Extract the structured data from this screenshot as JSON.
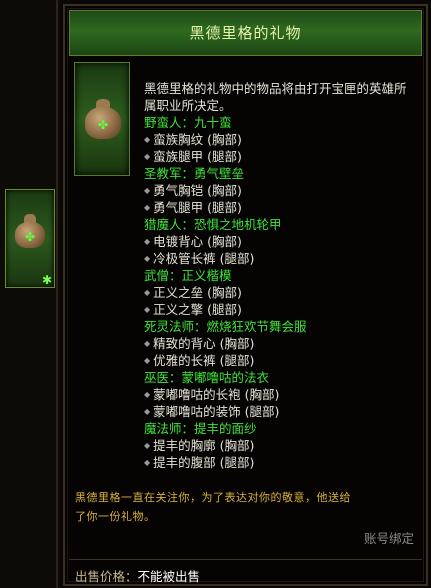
{
  "tooltip": {
    "title": "黑德里格的礼物",
    "description": "黑德里格的礼物中的物品将由打开宝匣的英雄所属职业所决定。",
    "classes": [
      {
        "header": "野蛮人：九十蛮",
        "items": [
          "蛮族胸纹 (胸部)",
          "蛮族腿甲 (腿部)"
        ]
      },
      {
        "header": "圣教军：勇气壁垒",
        "items": [
          "勇气胸铠 (胸部)",
          "勇气腿甲 (腿部)"
        ]
      },
      {
        "header": "猎魔人：恐惧之地机轮甲",
        "items": [
          "电镀背心 (胸部)",
          "冷极管长裤 (腿部)"
        ]
      },
      {
        "header": "武僧：正义楷模",
        "items": [
          "正义之垒 (胸部)",
          "正义之擎 (腿部)"
        ]
      },
      {
        "header": "死灵法师：燃烧狂欢节舞会服",
        "items": [
          "精致的背心 (胸部)",
          "优雅的长裤 (腿部)"
        ]
      },
      {
        "header": "巫医：蒙嘟噜咕的法衣",
        "items": [
          "蒙嘟噜咕的长袍 (胸部)",
          "蒙嘟噜咕的装饰 (腿部)"
        ]
      },
      {
        "header": "魔法师：提丰的面纱",
        "items": [
          "提丰的胸廓 (胸部)",
          "提丰的腹部 (腿部)"
        ]
      }
    ],
    "flavor_line1": "黑德里格一直在关注你，为了表达对你的敬意，他送给",
    "flavor_line2": "了你一份礼物。",
    "bind_status": "账号绑定",
    "sell_label": "出售价格：",
    "sell_value": "不能被出售"
  },
  "icons": {
    "item": "gift-bag-icon",
    "inventory_item": "gift-bag-icon",
    "bullet": "diamond-bullet-icon"
  },
  "colors": {
    "class_header": "#3fe33a",
    "item_text": "#e6e2d6",
    "flavor": "#d9b23a",
    "bind": "#8a8a8a",
    "frame": "#3a3122",
    "title_bg": "#2e6a20"
  }
}
